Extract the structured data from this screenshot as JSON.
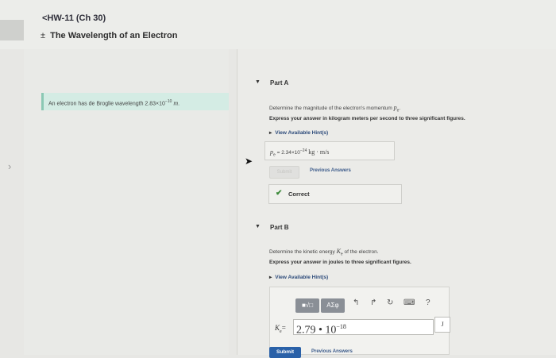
{
  "header": {
    "back_link": "<HW-11 (Ch 30)",
    "title_prefix": "±",
    "title": "The Wavelength of an Electron"
  },
  "question": {
    "text_before": "An electron has de Broglie wavelength",
    "mantissa": "2.83×10",
    "exponent": "−10",
    "unit": "m",
    "period": "."
  },
  "partA": {
    "title": "Part A",
    "prompt_before": "Determine the magnitude of the electron's momentum",
    "prompt_symbol": "p",
    "prompt_sub": "e",
    "prompt_after": ".",
    "instruction": "Express your answer in kilogram meters per second to three significant figures.",
    "hint_label": "View Available Hint(s)",
    "answer_symbol": "p",
    "answer_sub": "e",
    "answer_eq": "=",
    "answer_mantissa": "2.34×10",
    "answer_exponent": "−24",
    "answer_unit": "kg · m/s",
    "submit_label": "Submit",
    "previous_answers": "Previous Answers",
    "status_icon": "check-icon",
    "status_text": "Correct",
    "status_color": "#3c8a3a"
  },
  "partB": {
    "title": "Part B",
    "prompt_before": "Determine the kinetic energy",
    "prompt_symbol": "K",
    "prompt_sub": "e",
    "prompt_after": "of the electron.",
    "instruction": "Express your answer in joules to three significant figures.",
    "hint_label": "View Available Hint(s)",
    "toolbar": {
      "template_icon": "■√□",
      "symbols_label": "ΑΣφ",
      "icons": [
        "undo-icon",
        "redo-icon",
        "reset-icon",
        "keyboard-icon",
        "help-icon"
      ],
      "help_label": "?"
    },
    "k_symbol": "K",
    "k_sub": "e",
    "k_eq": "=",
    "answer_value": "2.79 • 10",
    "answer_exponent": "−18",
    "unit_value": "J",
    "submit_label": "Submit",
    "previous_answers": "Previous Answers"
  },
  "colors": {
    "accent": "#2a61a8",
    "question_bg": "#d4ece4"
  }
}
